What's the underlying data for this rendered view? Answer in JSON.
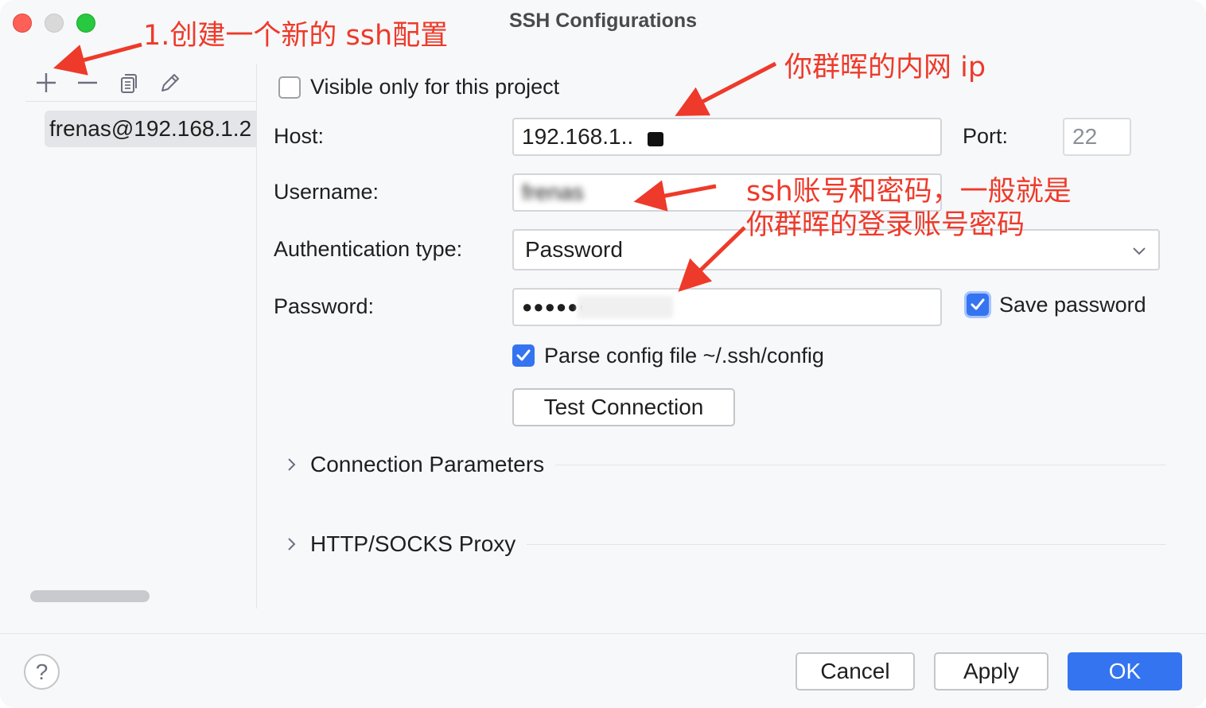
{
  "window": {
    "title": "SSH Configurations"
  },
  "toolbar": {
    "add_icon": "plus-icon",
    "remove_icon": "minus-icon",
    "copy_icon": "copy-icon",
    "edit_icon": "pencil-icon"
  },
  "configs": {
    "items": [
      {
        "label": "frenas@192.168.1.2"
      }
    ]
  },
  "form": {
    "visible_only_label": "Visible only for this project",
    "visible_only_checked": false,
    "host_label": "Host:",
    "host_value": "192.168.1..",
    "port_label": "Port:",
    "port_value": "22",
    "username_label": "Username:",
    "username_value": "frenas",
    "auth_type_label": "Authentication type:",
    "auth_type_value": "Password",
    "password_label": "Password:",
    "password_value": "●●●●●●●●●",
    "save_password_label": "Save password",
    "save_password_checked": true,
    "parse_config_label": "Parse config file ~/.ssh/config",
    "parse_config_checked": true,
    "test_connection_label": "Test Connection"
  },
  "sections": {
    "connection_parameters": "Connection Parameters",
    "proxy": "HTTP/SOCKS Proxy"
  },
  "footer": {
    "help_label": "?",
    "cancel_label": "Cancel",
    "apply_label": "Apply",
    "ok_label": "OK"
  },
  "annotations": {
    "create_new": "1.创建一个新的 ssh配置",
    "host_note": "你群晖的内网 ip",
    "account_note_line1": "ssh账号和密码，一般就是",
    "account_note_line2": "你群晖的登录账号密码"
  },
  "colors": {
    "accent": "#3574f0",
    "annotation": "#ee3a2a",
    "close": "#fe5f57",
    "maximize": "#28c840"
  }
}
